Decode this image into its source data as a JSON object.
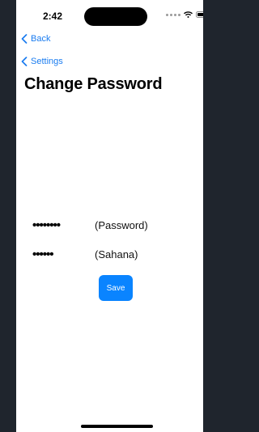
{
  "status_bar": {
    "time": "2:42",
    "icons": [
      "signal-dots-icon",
      "wifi-icon",
      "battery-icon"
    ]
  },
  "nav": {
    "back_label": "Back",
    "settings_label": "Settings",
    "icon": "chevron-left-icon"
  },
  "page": {
    "title": "Change Password"
  },
  "fields": [
    {
      "masked_value": "••••••••",
      "label": "(Password)"
    },
    {
      "masked_value": "••••••",
      "label": "(Sahana)"
    }
  ],
  "save_label": "Save",
  "colors": {
    "accent": "#0a84ff",
    "link": "#1a7cf0",
    "sidebar": "#1f252d",
    "background": "#ffffff"
  }
}
